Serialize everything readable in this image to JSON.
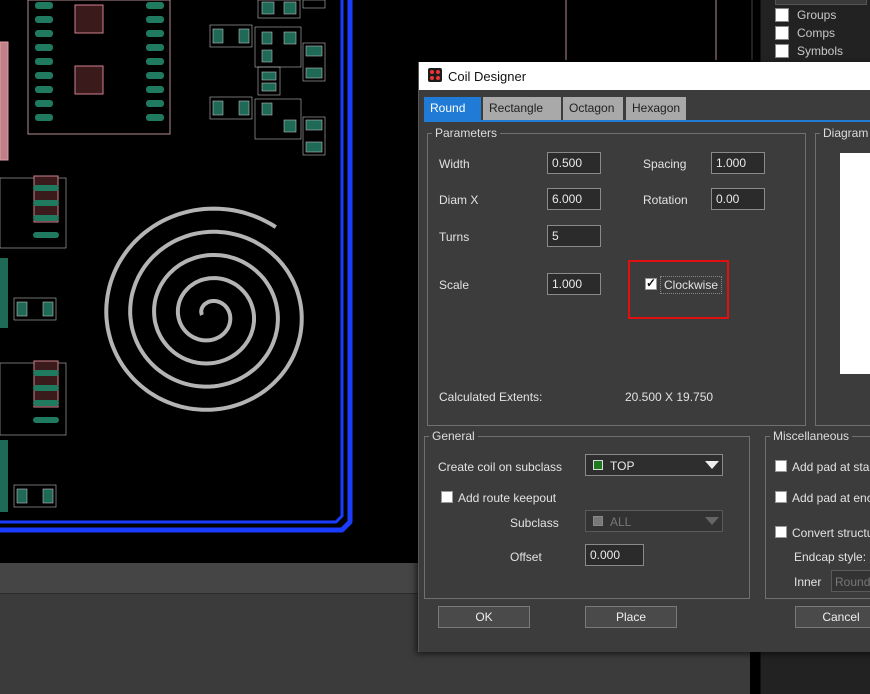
{
  "right_panel": {
    "items": [
      {
        "label": "Groups"
      },
      {
        "label": "Comps"
      },
      {
        "label": "Symbols"
      }
    ]
  },
  "dialog": {
    "title": "Coil Designer",
    "tabs": [
      "Round",
      "Rectangle",
      "Octagon",
      "Hexagon"
    ],
    "active_tab": "Round",
    "parameters": {
      "legend": "Parameters",
      "width_label": "Width",
      "width_value": "0.500",
      "spacing_label": "Spacing",
      "spacing_value": "1.000",
      "diamx_label": "Diam X",
      "diamx_value": "6.000",
      "rotation_label": "Rotation",
      "rotation_value": "0.00",
      "turns_label": "Turns",
      "turns_value": "5",
      "scale_label": "Scale",
      "scale_value": "1.000",
      "clockwise_label": "Clockwise",
      "clockwise_checked": true,
      "extents_label": "Calculated Extents:",
      "extents_value": "20.500 X 19.750"
    },
    "diagram": {
      "legend": "Diagram"
    },
    "general": {
      "legend": "General",
      "subclass_label": "Create coil on subclass",
      "subclass_value": "TOP",
      "route_keepout_label": "Add route keepout",
      "keepout_subclass_label": "Subclass",
      "keepout_subclass_value": "ALL",
      "offset_label": "Offset",
      "offset_value": "0.000"
    },
    "misc": {
      "legend": "Miscellaneous",
      "pad_start_label": "Add pad at star",
      "pad_end_label": "Add pad at enc",
      "convert_label": "Convert structu",
      "endcap_label": "Endcap style:",
      "inner_label": "Inner",
      "inner_value": "Round"
    },
    "buttons": {
      "ok": "OK",
      "place": "Place",
      "cancel": "Cancel"
    }
  },
  "colors": {
    "accent": "#1f7bd6",
    "highlight": "#e01010",
    "board_outline": "#1a3cff",
    "coil": "#b4b4b4"
  }
}
